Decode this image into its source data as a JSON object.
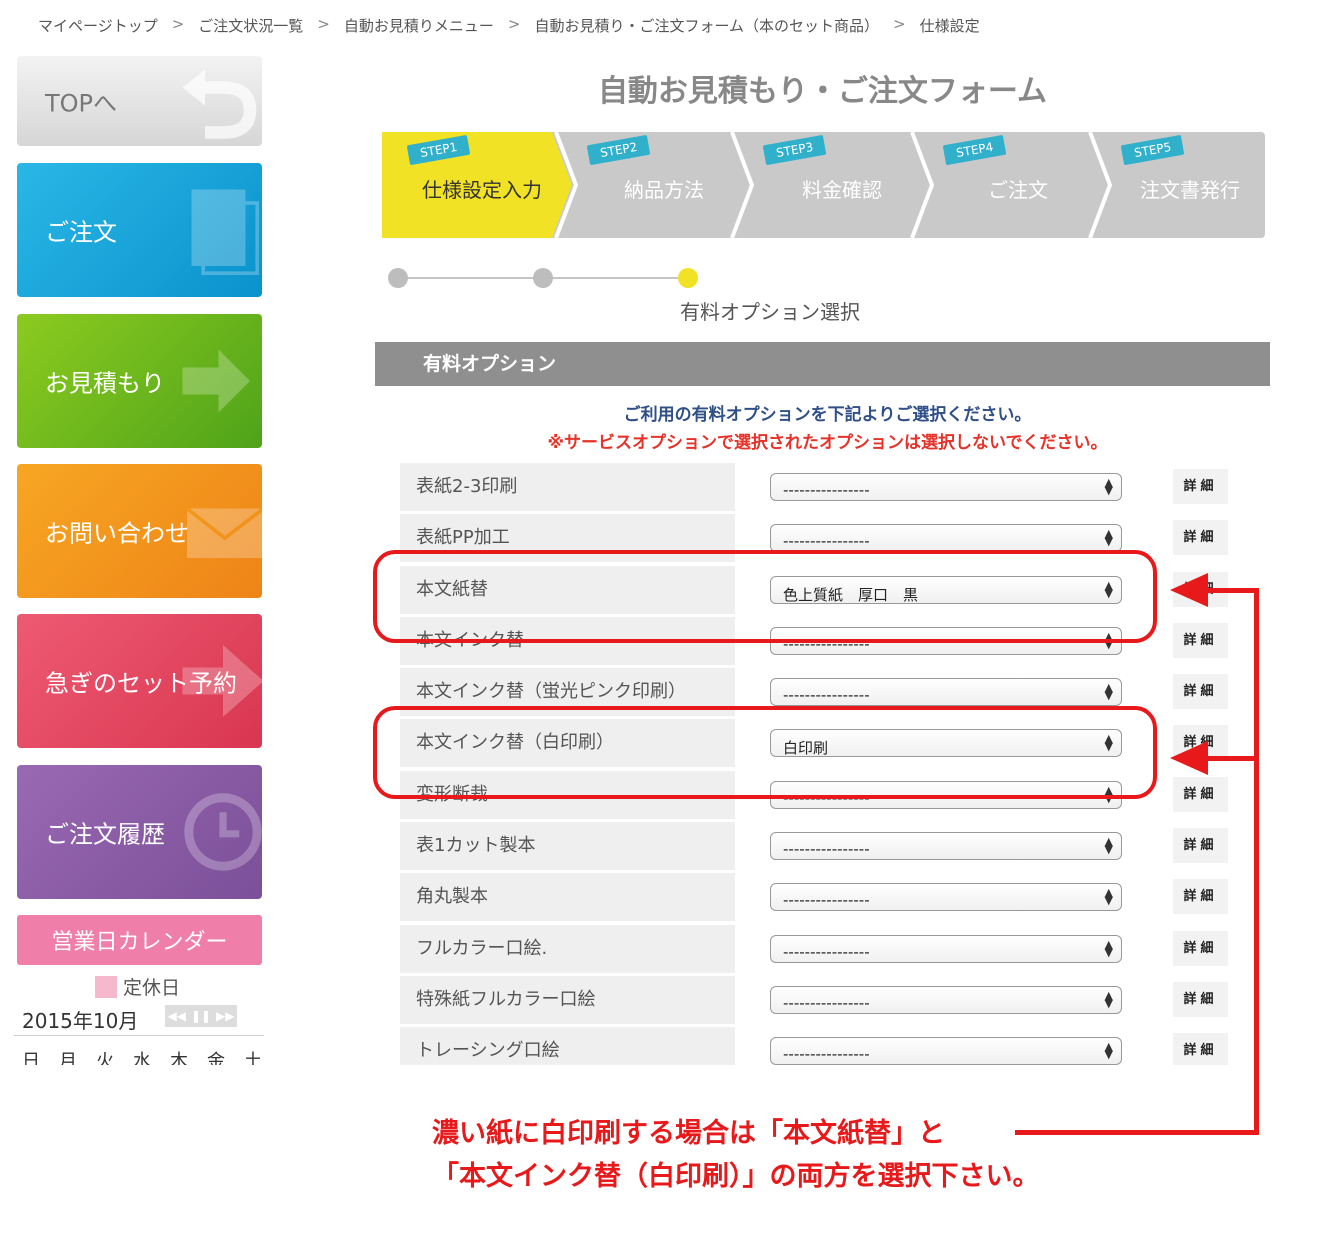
{
  "breadcrumb": [
    "マイページトップ",
    "ご注文状況一覧",
    "自動お見積りメニュー",
    "自動お見積り・ご注文フォーム（本のセット商品）",
    "仕様設定"
  ],
  "breadcrumb_sep": ">",
  "sidebar": {
    "top": "TOPへ",
    "order": "ご注文",
    "quote": "お見積もり",
    "contact": "お問い合わせ",
    "rush": "急ぎのセット予約",
    "history": "ご注文履歴"
  },
  "calendar": {
    "title": "営業日カレンダー",
    "holiday_legend": "定休日",
    "month": "2015年10月",
    "weekdays": [
      "日",
      "月",
      "火",
      "水",
      "木",
      "金",
      "土"
    ]
  },
  "form_title": "自動お見積もり・ご注文フォーム",
  "steps": [
    {
      "tag": "STEP1",
      "name": "仕様設定入力"
    },
    {
      "tag": "STEP2",
      "name": "納品方法"
    },
    {
      "tag": "STEP3",
      "name": "料金確認"
    },
    {
      "tag": "STEP4",
      "name": "ご注文"
    },
    {
      "tag": "STEP5",
      "name": "注文書発行"
    }
  ],
  "progress": {
    "label": "有料オプション選択",
    "current": 3,
    "total": 3
  },
  "section_title": "有料オプション",
  "instruction": "ご利用の有料オプションを下記よりご選択ください。",
  "warning": "※サービスオプションで選択されたオプションは選択しないでください。",
  "detail_label": "詳細",
  "options": [
    {
      "label": "表紙2-3印刷",
      "value": "----------------"
    },
    {
      "label": "表紙PP加工",
      "value": "----------------"
    },
    {
      "label": "本文紙替",
      "value": "色上質紙　厚口　黒"
    },
    {
      "label": "本文インク替",
      "value": "----------------"
    },
    {
      "label": "本文インク替（蛍光ピンク印刷）",
      "value": "----------------"
    },
    {
      "label": "本文インク替（白印刷）",
      "value": "白印刷"
    },
    {
      "label": "変形断裁",
      "value": "----------------"
    },
    {
      "label": "表1カット製本",
      "value": "----------------"
    },
    {
      "label": "角丸製本",
      "value": "----------------"
    },
    {
      "label": "フルカラー口絵.",
      "value": "----------------"
    },
    {
      "label": "特殊紙フルカラー口絵",
      "value": "----------------"
    },
    {
      "label": "トレーシング口絵",
      "value": "----------------"
    }
  ],
  "annotation": {
    "line1": "濃い紙に白印刷する場合は「本文紙替」と",
    "line2": "「本文インク替（白印刷）」の両方を選択下さい。",
    "color": "#e8191b"
  },
  "colors": {
    "step_active": "#f2e225",
    "step_inactive": "#c9c9c9",
    "step_tag": "#31b0cb",
    "progress_active": "#f2e225"
  }
}
